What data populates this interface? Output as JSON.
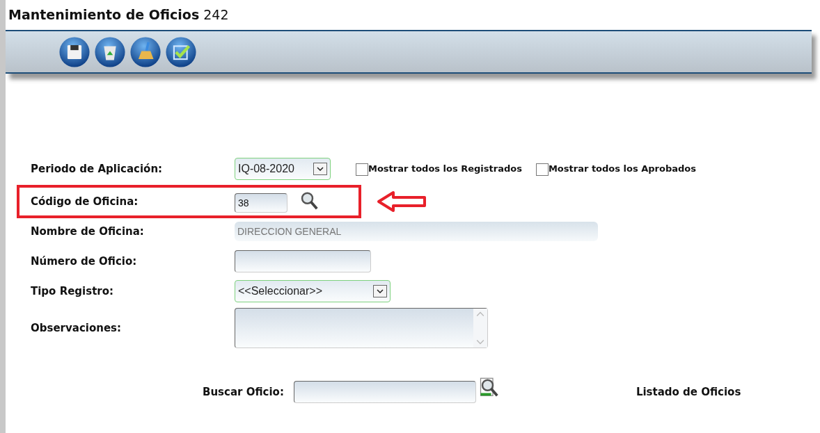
{
  "title": {
    "text": "Mantenimiento de Oficios",
    "number": "242"
  },
  "toolbar": [
    {
      "kind": "save"
    },
    {
      "kind": "recycle"
    },
    {
      "kind": "clean"
    },
    {
      "kind": "approve"
    }
  ],
  "form": [
    {
      "kind": "select",
      "label": "Periodo de Aplicación:",
      "value": "IQ-08-2020",
      "highlighted": false
    },
    {
      "kind": "code",
      "label": "Código de Oficina:",
      "value": "38",
      "highlighted": true
    },
    {
      "kind": "readonly",
      "label": "Nombre de Oficina:",
      "value": "DIRECCION GENERAL",
      "highlighted": false
    },
    {
      "kind": "text",
      "label": "Número de Oficio:",
      "highlighted": false
    },
    {
      "kind": "select",
      "label": "Tipo Registro:",
      "value": "<<Seleccionar>>",
      "highlighted": false
    },
    {
      "kind": "textarea",
      "label": "Observaciones:",
      "highlighted": false
    }
  ],
  "filters": [
    {
      "label": "Mostrar todos los Registrados",
      "checked": false
    },
    {
      "label": "Mostrar todos los Aprobados",
      "checked": false
    }
  ],
  "search": {
    "label": "Buscar Oficio:"
  },
  "list_link": "Listado de Oficios"
}
